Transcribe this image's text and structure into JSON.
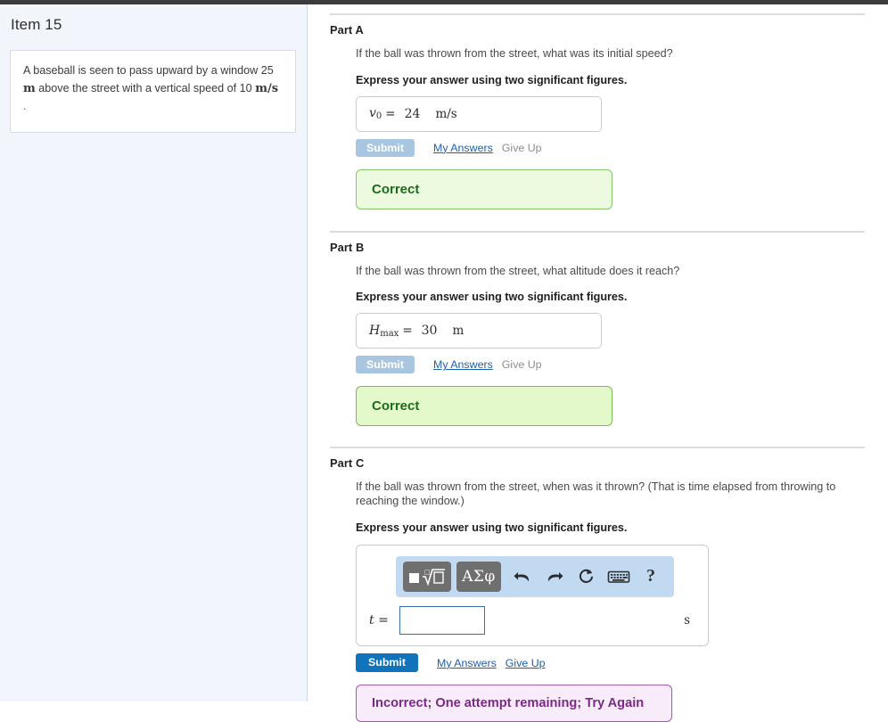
{
  "sidebar": {
    "item_title": "Item 15",
    "problem_statement_prefix": "A baseball is seen to pass upward by a window 25 ",
    "problem_statement_unit1": "m",
    "problem_statement_mid": " above the street with a vertical speed of 10 ",
    "problem_statement_unit2": "m/s",
    "problem_statement_tail": "."
  },
  "parts": [
    {
      "label": "Part A",
      "question": "If the ball was thrown from the street, what was its initial speed?",
      "instruction": "Express your answer using two significant figures.",
      "answer": {
        "variable": "v",
        "subscript": "0",
        "equals": "=",
        "value": "24",
        "unit": "m/s"
      },
      "submit_label": "Submit",
      "my_answers_label": "My Answers",
      "give_up_label": "Give Up",
      "feedback": "Correct"
    },
    {
      "label": "Part B",
      "question": "If the ball was thrown from the street, what altitude does it reach?",
      "instruction": "Express your answer using two significant figures.",
      "answer": {
        "variable": "H",
        "subscript": "max",
        "equals": "=",
        "value": "30",
        "unit": "m"
      },
      "submit_label": "Submit",
      "my_answers_label": "My Answers",
      "give_up_label": "Give Up",
      "feedback": "Correct"
    },
    {
      "label": "Part C",
      "question": "If the ball was thrown from the street, when was it thrown? (That is time elapsed from throwing to reaching the window.)",
      "instruction": "Express your answer using two significant figures.",
      "answer": {
        "variable": "t",
        "equals": "=",
        "value": "",
        "unit": "s"
      },
      "toolbar": {
        "template_button": "template-icon",
        "greek_button": "ΑΣφ",
        "undo_button": "undo-icon",
        "redo_button": "redo-icon",
        "reset_button": "reset-icon",
        "keyboard_button": "keyboard-icon",
        "help_button": "?"
      },
      "submit_label": "Submit",
      "my_answers_label": "My Answers",
      "give_up_label": "Give Up",
      "feedback": "Incorrect; One attempt remaining; Try Again"
    }
  ],
  "colors": {
    "sidebar_bg": "#f2f5fc",
    "submit_active": "#1173ba",
    "submit_disabled": "#a9c6e0",
    "link": "#2060a8",
    "correct_bg": "#ecfbe0",
    "correct_border": "#87c66a",
    "correct_text": "#1d6b1d",
    "incorrect_bg": "#f8ecfa",
    "incorrect_border": "#9c5ca8",
    "incorrect_text": "#7a2a86",
    "mathbar_bg": "#c2daf1",
    "tool_button_bg": "#6f6f6f"
  }
}
